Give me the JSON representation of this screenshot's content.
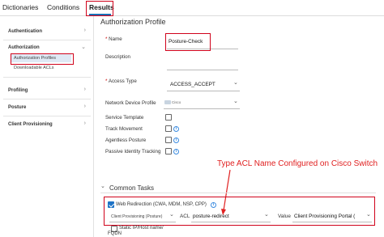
{
  "tabs": [
    {
      "label": "Dictionaries"
    },
    {
      "label": "Conditions"
    },
    {
      "label": "Results"
    }
  ],
  "sidebar": {
    "authentication": "Authentication",
    "authorization": "Authorization",
    "authz_profiles": "Authorization Profiles",
    "downloadable_acls": "Downloadable ACLs",
    "profiling": "Profiling",
    "posture": "Posture",
    "client_provisioning": "Client Provisioning"
  },
  "form": {
    "title": "Authorization Profile",
    "name_label": "Name",
    "name_value": "Posture-Check",
    "description_label": "Description",
    "access_type_label": "Access Type",
    "access_type_value": "ACCESS_ACCEPT",
    "ndp_label": "Network Device Profile",
    "ndp_value": "Cisco",
    "service_template_label": "Service Template",
    "track_movement_label": "Track Movement",
    "agentless_posture_label": "Agentless Posture",
    "passive_identity_label": "Passive Identity Tracking"
  },
  "annotation": "Type ACL Name Configured on Cisco Switch",
  "common_tasks": {
    "heading": "Common Tasks",
    "web_redirection_label": "Web Redirection (CWA, MDM, NSP, CPP)",
    "redirect_type": "Client Provisioning (Posture)",
    "acl_label": "ACL",
    "acl_value": "posture-redirect",
    "value_label": "Value",
    "value_value": "Client Provisioning Portal (",
    "static_ip_label": "Static IP/Host name/",
    "fqdn_label": "FQDN"
  },
  "colors": {
    "accent": "#1f73c6",
    "highlight_red": "#d0021b",
    "annotation": "#e02020"
  }
}
